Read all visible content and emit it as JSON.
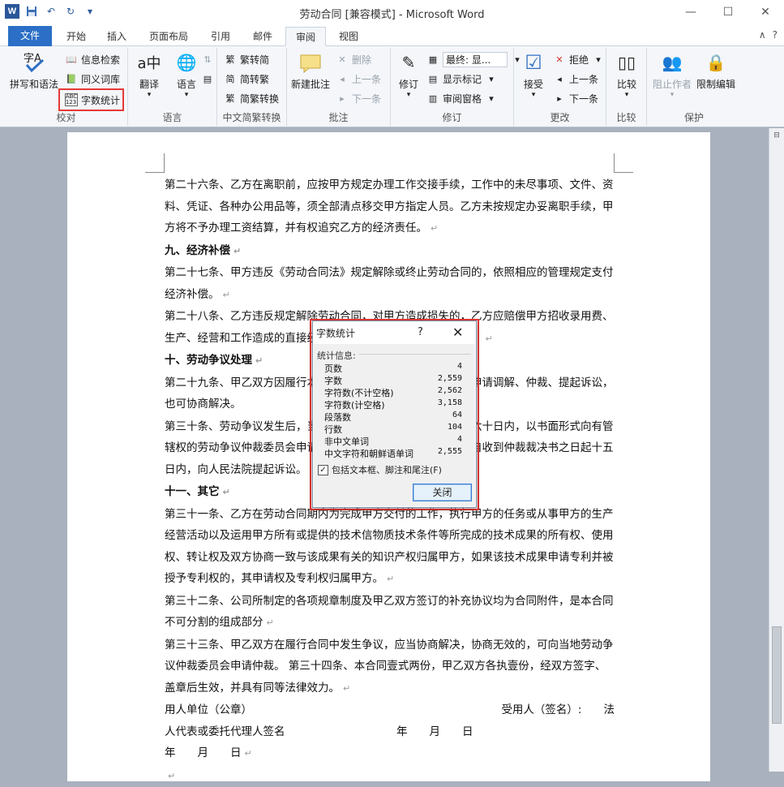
{
  "app": {
    "title": "劳动合同 [兼容模式] - Microsoft Word",
    "logo": "W",
    "window_controls": {
      "minimize": "—",
      "maximize": "☐",
      "close": "✕"
    }
  },
  "tabs": [
    "文件",
    "开始",
    "插入",
    "页面布局",
    "引用",
    "邮件",
    "审阅",
    "视图"
  ],
  "active_tab": "审阅",
  "tabbar_right": [
    "∧",
    "?"
  ],
  "ribbon": {
    "proofing": {
      "label": "校对",
      "spell": "拼写和语法",
      "research": "信息检索",
      "thesaurus": "同义词库",
      "wordcount": "字数统计"
    },
    "language": {
      "label": "语言",
      "translate": "翻译",
      "language": "语言"
    },
    "chinese": {
      "label": "中文简繁转换",
      "to_simplified": "繁转简",
      "to_traditional": "简转繁",
      "convert": "简繁转换"
    },
    "comments": {
      "label": "批注",
      "new": "新建批注",
      "delete": "删除",
      "prev": "上一条",
      "next": "下一条"
    },
    "tracking": {
      "label": "修订",
      "track": "修订",
      "final": "最终: 显...",
      "show_markup": "显示标记",
      "pane": "审阅窗格"
    },
    "changes": {
      "label": "更改",
      "accept": "接受",
      "reject": "拒绝",
      "prev": "上一条",
      "next": "下一条"
    },
    "compare": {
      "label": "比较",
      "compare": "比较"
    },
    "protect": {
      "label": "保护",
      "block": "阻止作者",
      "restrict": "限制编辑"
    }
  },
  "document": {
    "paragraphs": [
      {
        "text": "第二十六条、乙方在离职前，应按甲方规定办理工作交接手续，工作中的未尽事项、文件、资料、凭证、各种办公用品等，须全部清点移交甲方指定人员。乙方未按规定办妥离职手续，甲方将不予办理工资结算，并有权追究乙方的经济责任。",
        "mark": "↵"
      },
      {
        "text": "九、经济补偿",
        "mark": "↵",
        "heading": true
      },
      {
        "text": "第二十七条、甲方违反《劳动合同法》规定解除或终止劳动合同的，依照相应的管理规定支付经济补偿。",
        "mark": "↵"
      },
      {
        "text": "第二十八条、乙方违反规定解除劳动合同，对甲方造成损失的，乙方应赔偿甲方招收录用费、生产、经营和工作造成的直接经济损失，并承担相应的赔偿责任。",
        "mark": "↵"
      },
      {
        "text": "十、劳动争议处理",
        "mark": "↵",
        "heading": true
      },
      {
        "text": "第二十九条、甲乙双方因履行本合同发生争议，当事人可以依法申请调解、仲裁、提起诉讼，也可协商解决。",
        "mark": ""
      },
      {
        "text": "第三十条、劳动争议发生后，当事人应当在劳动争议发生之日起六十日内，以书面形式向有管辖权的劳动争议仲裁委员会申请仲裁；对仲裁裁决不服的，可以自收到仲裁裁决书之日起十五日内，向人民法院提起诉讼。",
        "mark": ""
      },
      {
        "text": "十一、其它",
        "mark": "↵",
        "heading": true
      },
      {
        "text": "第三十一条、乙方在劳动合同期内为完成甲方交付的工作，执行甲方的任务或从事甲方的生产经营活动以及运用甲方所有或提供的技术信物质技术条件等所完成的技术成果的所有权、使用权、转让权及双方协商一致与该成果有关的知识产权归属甲方，如果该技术成果申请专利并被授予专利权的，其申请权及专利权归属甲方。",
        "mark": "↵"
      },
      {
        "text": "第三十二条、公司所制定的各项规章制度及甲乙双方签订的补充协议均为合同附件，是本合同不可分割的组成部分",
        "mark": "↵"
      },
      {
        "text": "第三十三条、甲乙双方在履行合同中发生争议，应当协商解决，协商无效的，可向当地劳动争议仲裁委员会申请仲裁。 第三十四条、本合同壹式两份，甲乙双方各执壹份，经双方签字、盖章后生效，并具有同等法律效力。",
        "mark": "↵"
      }
    ],
    "signature": {
      "line1_left": "用人单位（公章）",
      "line1_right": "受用人（签名）:　　法",
      "line2_left": "人代表或委托代理人签名",
      "line2_right": "年　　月　　日",
      "line3": "年　　月　　日",
      "mark": "↵"
    }
  },
  "dialog": {
    "title": "字数统计",
    "help": "?",
    "close_x": "✕",
    "stats_label": "统计信息:",
    "stats": [
      {
        "label": "页数",
        "value": "4"
      },
      {
        "label": "字数",
        "value": "2,559"
      },
      {
        "label": "字符数(不计空格)",
        "value": "2,562"
      },
      {
        "label": "字符数(计空格)",
        "value": "3,158"
      },
      {
        "label": "段落数",
        "value": "64"
      },
      {
        "label": "行数",
        "value": "104"
      },
      {
        "label": "非中文单词",
        "value": "4"
      },
      {
        "label": "中文字符和朝鲜语单词",
        "value": "2,555"
      }
    ],
    "checkbox_label": "包括文本框、脚注和尾注(F)",
    "checkbox_checked": "✓",
    "close_button": "关闭"
  }
}
